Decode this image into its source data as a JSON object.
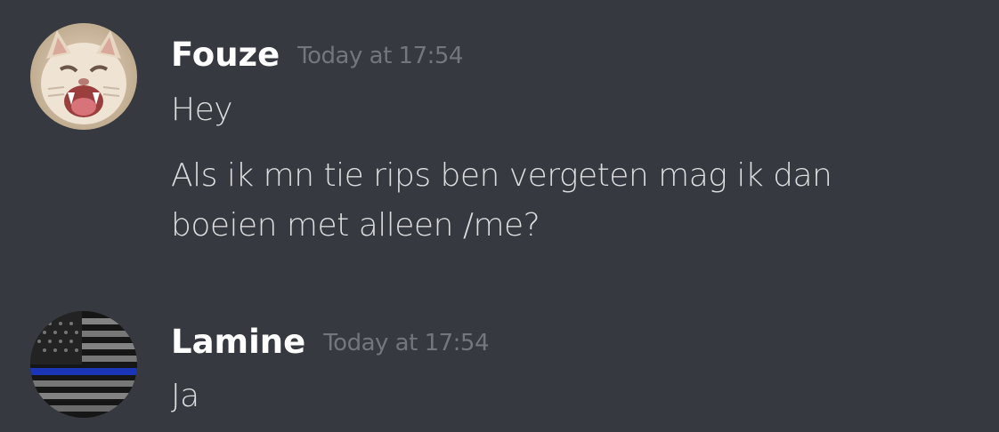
{
  "messages": [
    {
      "author": "Fouze",
      "timestamp": "Today at 17:54",
      "avatar_icon": "cat-avatar",
      "lines": [
        "Hey",
        "Als ik mn tie rips ben vergeten mag ik dan\nboeien met alleen /me?"
      ]
    },
    {
      "author": "Lamine",
      "timestamp": "Today at 17:54",
      "avatar_icon": "thin-blue-line-flag-avatar",
      "lines": [
        "Ja"
      ]
    }
  ],
  "colors": {
    "background": "#36393f",
    "username": "#ffffff",
    "timestamp": "#72767d",
    "message_text": "#dcddde",
    "flag_blue_line": "#1f3fd6"
  }
}
